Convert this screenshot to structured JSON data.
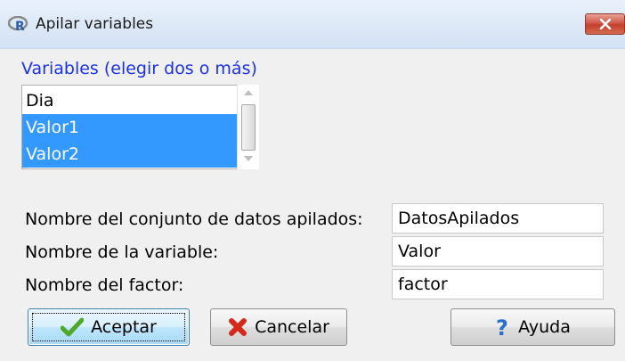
{
  "window": {
    "title": "Apilar variables"
  },
  "variables": {
    "label": "Variables (elegir dos o más)",
    "items": [
      {
        "label": "Dia",
        "selected": false
      },
      {
        "label": "Valor1",
        "selected": true
      },
      {
        "label": "Valor2",
        "selected": true
      }
    ]
  },
  "fields": {
    "dataset": {
      "label": "Nombre del conjunto de datos apilados:",
      "value": "DatosApilados"
    },
    "variable": {
      "label": "Nombre de la variable:",
      "value": "Valor"
    },
    "factor": {
      "label": "Nombre del factor:",
      "value": "factor"
    }
  },
  "buttons": {
    "accept": "Aceptar",
    "cancel": "Cancelar",
    "help": "Ayuda"
  },
  "icons": {
    "app": "r-logo-icon",
    "close": "close-icon",
    "accept": "checkmark-icon",
    "cancel": "red-x-icon",
    "help": "question-mark-icon"
  },
  "colors": {
    "selection": "#3399ff",
    "label_blue": "#1b33e3",
    "close_red": "#c9463a"
  }
}
